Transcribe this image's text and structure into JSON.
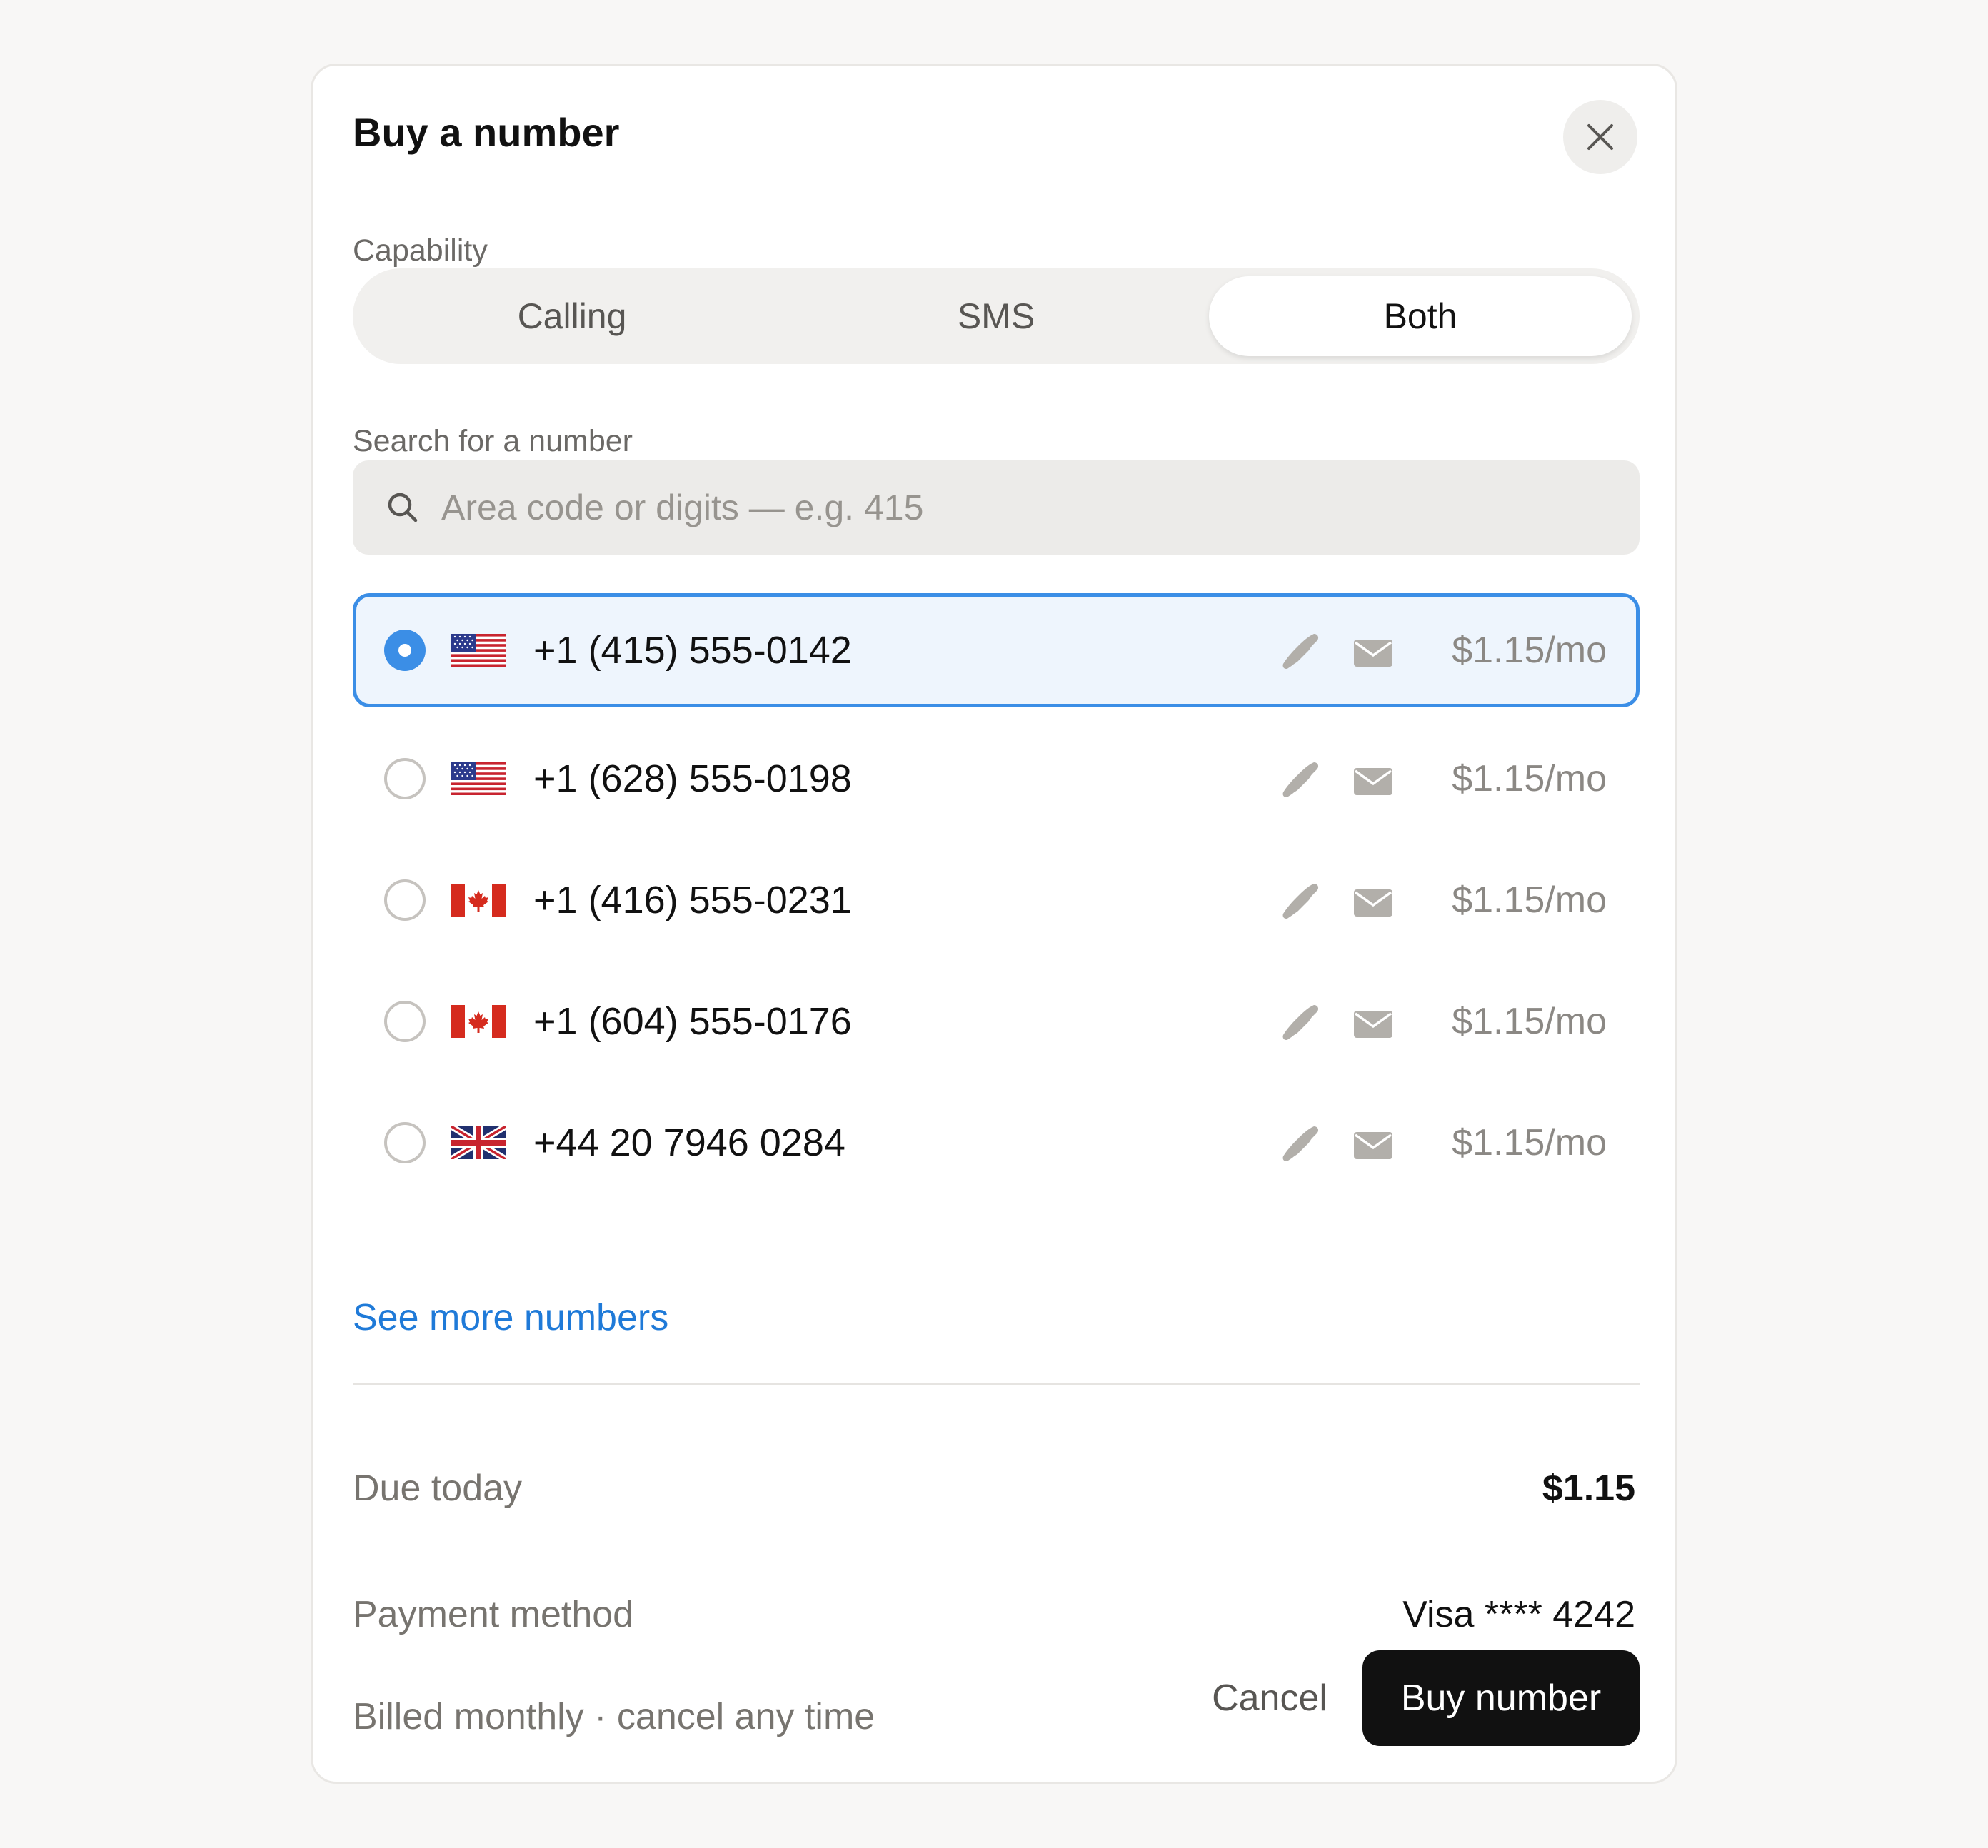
{
  "dialog": {
    "title": "Buy a number",
    "capability": {
      "label": "Capability",
      "options": [
        "Calling",
        "SMS",
        "Both"
      ],
      "selected": "Both"
    },
    "search": {
      "label": "Search for a number",
      "placeholder": "Area code or digits — e.g. 415",
      "value": ""
    },
    "numbers": [
      {
        "flag": "us-flag-icon",
        "number": "+1 (415) 555-0142",
        "price": "$1.15/mo",
        "selected": true
      },
      {
        "flag": "us-flag-icon",
        "number": "+1 (628) 555-0198",
        "price": "$1.15/mo",
        "selected": false
      },
      {
        "flag": "ca-flag-icon",
        "number": "+1 (416) 555-0231",
        "price": "$1.15/mo",
        "selected": false
      },
      {
        "flag": "ca-flag-icon",
        "number": "+1 (604) 555-0176",
        "price": "$1.15/mo",
        "selected": false
      },
      {
        "flag": "uk-flag-icon",
        "number": "+44 20 7946 0284",
        "price": "$1.15/mo",
        "selected": false
      }
    ],
    "see_more": "See more numbers",
    "summary": {
      "due_today_label": "Due today",
      "due_today_value": "$1.15",
      "payment_method_label": "Payment method",
      "payment_method_value": "Visa **** 4242"
    },
    "footer": {
      "note": "Billed monthly · cancel any time",
      "cancel_label": "Cancel",
      "buy_label": "Buy number"
    }
  },
  "colors": {
    "accent": "#3b8ee6",
    "link": "#1f7ad8",
    "primary_button": "#111111",
    "selected_row_bg": "#eef5fd"
  }
}
